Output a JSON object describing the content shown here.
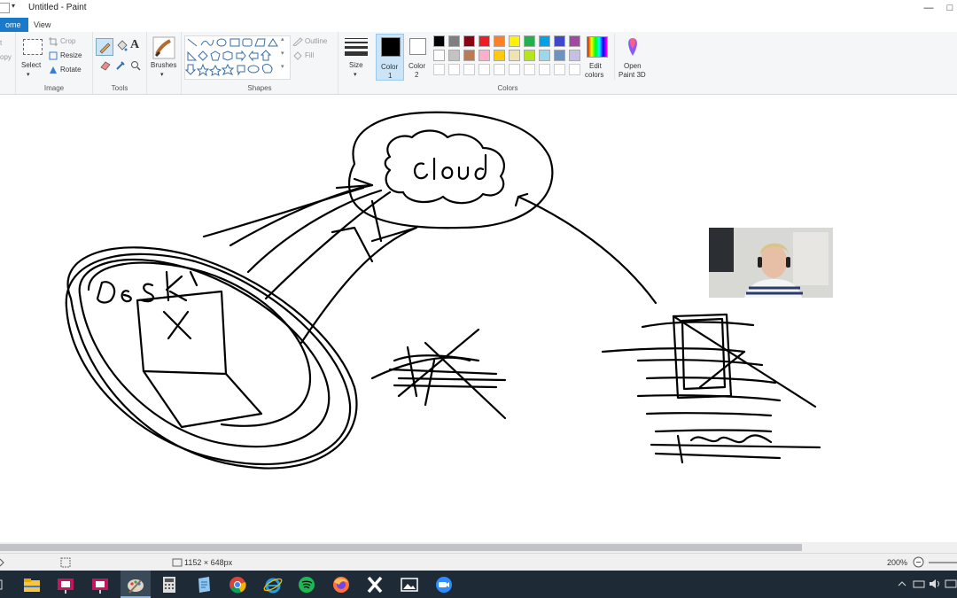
{
  "window": {
    "title": "Untitled - Paint",
    "minimize_glyph": "—",
    "restore_glyph": "□",
    "qa_arrow": "▾"
  },
  "tabs": {
    "home": "Home",
    "home_visible": "ome",
    "view": "View"
  },
  "ribbon": {
    "clipboard_partial": {
      "cut": "t",
      "copy": "opy"
    },
    "image": {
      "label": "Image",
      "select": "Select",
      "crop": "Crop",
      "resize": "Resize",
      "rotate": "Rotate"
    },
    "tools": {
      "label": "Tools",
      "text_glyph": "A"
    },
    "brushes": {
      "label": "Brushes"
    },
    "shapes": {
      "label": "Shapes",
      "outline": "Outline",
      "fill": "Fill"
    },
    "size": {
      "label": "Size"
    },
    "color1": {
      "label": "Color",
      "num": "1",
      "value": "#000000"
    },
    "color2": {
      "label": "Color",
      "num": "2",
      "value": "#ffffff"
    },
    "colors": {
      "label": "Colors"
    },
    "edit_colors": {
      "line1": "Edit",
      "line2": "colors"
    },
    "paint3d": {
      "line1": "Open",
      "line2": "Paint 3D"
    },
    "palette_row1": [
      "#000000",
      "#7f7f7f",
      "#880015",
      "#ed1c24",
      "#ff7f27",
      "#fff200",
      "#22b14c",
      "#00a2e8",
      "#3f48cc",
      "#a349a4"
    ],
    "palette_row2": [
      "#ffffff",
      "#c3c3c3",
      "#b97a57",
      "#ffaec9",
      "#ffc90e",
      "#efe4b0",
      "#b5e61d",
      "#99d9ea",
      "#7092be",
      "#c8bfe7"
    ]
  },
  "status": {
    "dimensions": "1152 × 648px",
    "zoom": "200%"
  },
  "taskbar": {
    "apps": [
      "file-explorer-icon",
      "slides-icon",
      "slides-icon",
      "paint-icon",
      "calculator-icon",
      "notepad-icon",
      "chrome-icon",
      "ie-icon",
      "spotify-icon",
      "firefox-icon",
      "x-app-icon",
      "photos-icon",
      "zoom-icon"
    ]
  }
}
